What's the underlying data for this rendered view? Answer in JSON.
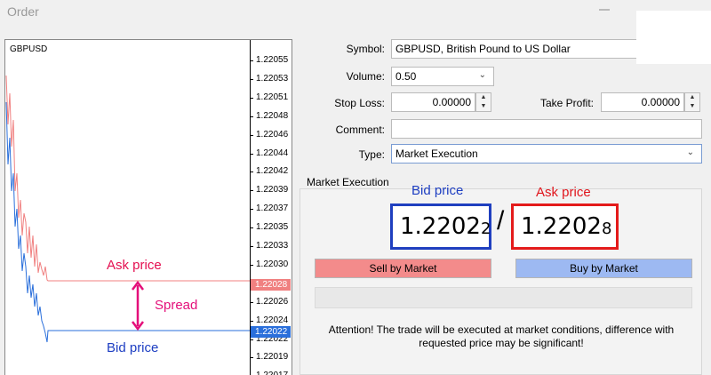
{
  "window": {
    "title": "Order"
  },
  "chart": {
    "symbol": "GBPUSD",
    "tick_labels": [
      "1.22055",
      "1.22053",
      "1.22051",
      "1.22048",
      "1.22046",
      "1.22044",
      "1.22042",
      "1.22039",
      "1.22037",
      "1.22035",
      "1.22033",
      "1.22030",
      "1.22028",
      "1.22026",
      "1.22024",
      "1.22022",
      "1.22019",
      "1.22017"
    ],
    "ask_tag": "1.22028",
    "bid_tag": "1.22022",
    "ask_line_color": "#f08080",
    "bid_line_color": "#2a6fdb"
  },
  "annotations": {
    "chart_ask": "Ask price",
    "chart_spread": "Spread",
    "chart_bid": "Bid price",
    "bid_price_label": "Bid price",
    "ask_price_label": "Ask price"
  },
  "form": {
    "symbol_label": "Symbol:",
    "symbol_value": "GBPUSD, British Pound to US Dollar",
    "volume_label": "Volume:",
    "volume_value": "0.50",
    "stoploss_label": "Stop Loss:",
    "stoploss_value": "0.00000",
    "takeprofit_label": "Take Profit:",
    "takeprofit_value": "0.00000",
    "comment_label": "Comment:",
    "comment_value": "",
    "type_label": "Type:",
    "type_value": "Market Execution"
  },
  "market": {
    "group_title": "Market Execution",
    "bid_main": "1.2202",
    "bid_last": "2",
    "ask_main": "1.2202",
    "ask_last": "8",
    "separator": "/",
    "sell_button": "Sell by Market",
    "buy_button": "Buy by Market",
    "attention_line1": "Attention! The trade will be executed at market conditions, difference with",
    "attention_line2": "requested price may be significant!"
  }
}
